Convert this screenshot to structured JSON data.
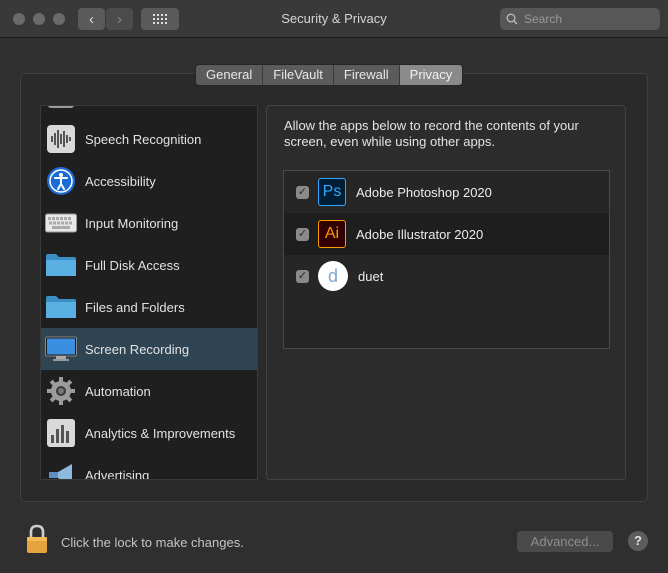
{
  "window": {
    "title": "Security & Privacy",
    "search_placeholder": "Search",
    "back_glyph": "‹",
    "forward_glyph": "›"
  },
  "tabs": [
    {
      "label": "General"
    },
    {
      "label": "FileVault"
    },
    {
      "label": "Firewall"
    },
    {
      "label": "Privacy",
      "active": true
    }
  ],
  "sidebar": {
    "items": [
      {
        "label": "Speech Recognition",
        "icon": "speech-waveform-icon"
      },
      {
        "label": "Accessibility",
        "icon": "accessibility-icon"
      },
      {
        "label": "Input Monitoring",
        "icon": "keyboard-icon"
      },
      {
        "label": "Full Disk Access",
        "icon": "folder-icon"
      },
      {
        "label": "Files and Folders",
        "icon": "folder-icon"
      },
      {
        "label": "Screen Recording",
        "icon": "display-icon",
        "selected": true
      },
      {
        "label": "Automation",
        "icon": "gear-icon"
      },
      {
        "label": "Analytics & Improvements",
        "icon": "analytics-icon"
      },
      {
        "label": "Advertising",
        "icon": "megaphone-icon"
      }
    ]
  },
  "main": {
    "description": "Allow the apps below to record the contents of your screen, even while using other apps.",
    "apps": [
      {
        "name": "Adobe Photoshop 2020",
        "checked": true,
        "icon": "photoshop-icon",
        "icon_text": "Ps"
      },
      {
        "name": "Adobe Illustrator 2020",
        "checked": true,
        "icon": "illustrator-icon",
        "icon_text": "Ai"
      },
      {
        "name": "duet",
        "checked": true,
        "icon": "duet-icon",
        "icon_text": "d"
      }
    ],
    "checkmark": "✓"
  },
  "footer": {
    "lock_text": "Click the lock to make changes.",
    "advanced_label": "Advanced...",
    "help_label": "?"
  },
  "colors": {
    "selection": "#2f4553",
    "photoshop_blue": "#31a8ff",
    "illustrator_orange": "#ff9a00",
    "lock_gold": "#e6a23c"
  }
}
